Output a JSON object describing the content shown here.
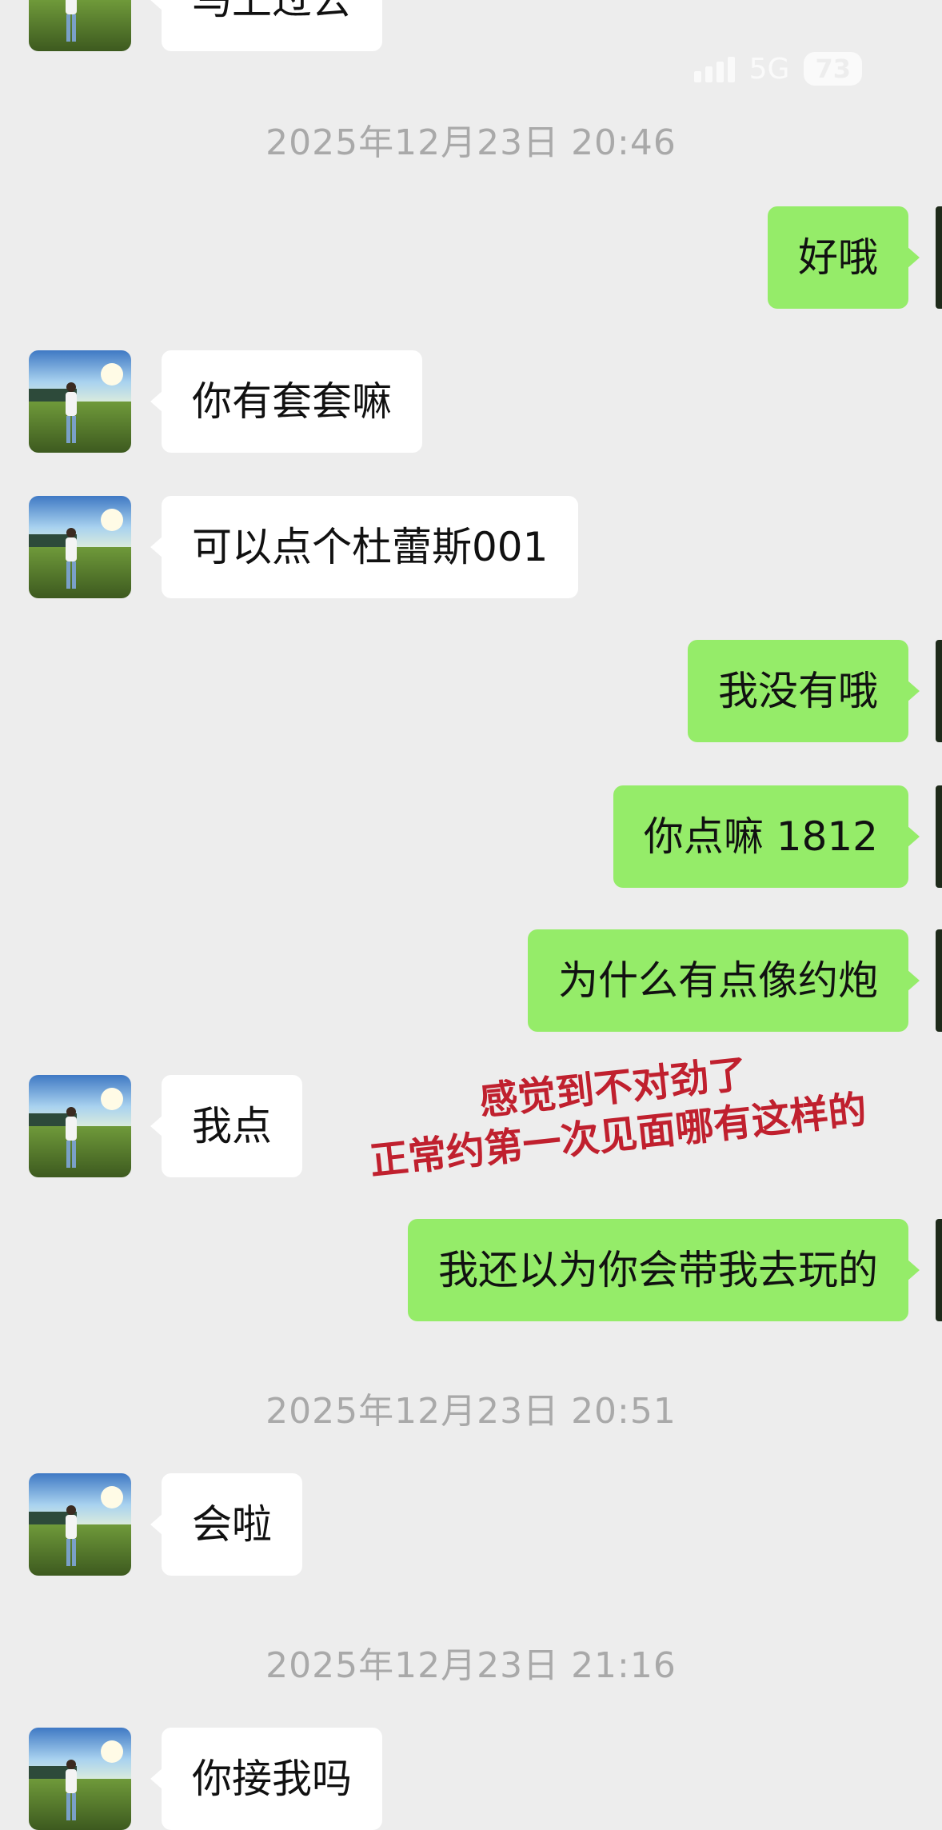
{
  "status_bar": {
    "network": "5G",
    "battery": "73"
  },
  "messages_top": {
    "partial_text": "马上过去"
  },
  "timestamps": [
    "2025年12月23日 20:46",
    "2025年12月23日 20:51",
    "2025年12月23日 21:16"
  ],
  "messages": [
    {
      "side": "out",
      "text": "好哦"
    },
    {
      "side": "in",
      "text": "你有套套嘛"
    },
    {
      "side": "in",
      "text": "可以点个杜蕾斯001"
    },
    {
      "side": "out",
      "text": "我没有哦"
    },
    {
      "side": "out",
      "text": "你点嘛 1812"
    },
    {
      "side": "out",
      "text": "为什么有点像约炮"
    },
    {
      "side": "in",
      "text": "我点"
    },
    {
      "side": "out",
      "text": "我还以为你会带我去玩的"
    },
    {
      "side": "in",
      "text": "会啦"
    },
    {
      "side": "in",
      "text": "你接我吗"
    }
  ],
  "annotation": {
    "line1": "感觉到不对劲了",
    "line2": "正常约第一次见面哪有这样的",
    "color": "#c0202e"
  },
  "colors": {
    "background": "#ededed",
    "outgoing_bubble": "#95ec69",
    "incoming_bubble": "#ffffff",
    "timestamp": "#a9a9a9"
  }
}
